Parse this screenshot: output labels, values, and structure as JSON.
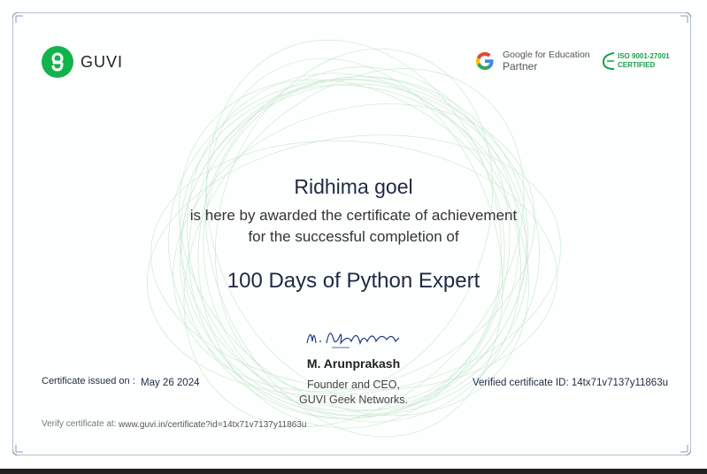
{
  "brand": {
    "name": "GUVI",
    "partner_line1": "Google for Education",
    "partner_line2": "Partner",
    "iso_line1": "ISO 9001-27001",
    "iso_line2": "CERTIFIED",
    "icons": [
      "guvi-logo-icon",
      "google-g-icon",
      "iso-leaf-icon",
      "signature-icon",
      "wave-pattern"
    ]
  },
  "certificate": {
    "recipient": "Ridhima goel",
    "line1": "is here by awarded the certificate of achievement",
    "line2": "for the successful completion of",
    "course": "100 Days of Python Expert"
  },
  "signatory": {
    "name": "M. Arunprakash",
    "title1": "Founder and CEO,",
    "title2": "GUVI Geek Networks."
  },
  "issue": {
    "label": "Certificate issued on :",
    "date": "May 26 2024"
  },
  "verification": {
    "id_text": "Verified certificate ID: 14tx71v7137y11863u",
    "label": "Verify certificate at:",
    "url": "www.guvi.in/certificate?id=14tx71v7137y11863u"
  },
  "colors": {
    "brand_green": "#11b34c",
    "iso_green": "#18a04a",
    "text_navy": "#1e2a44",
    "frame": "#8a9bb5",
    "pattern": "#bfe6c8"
  }
}
